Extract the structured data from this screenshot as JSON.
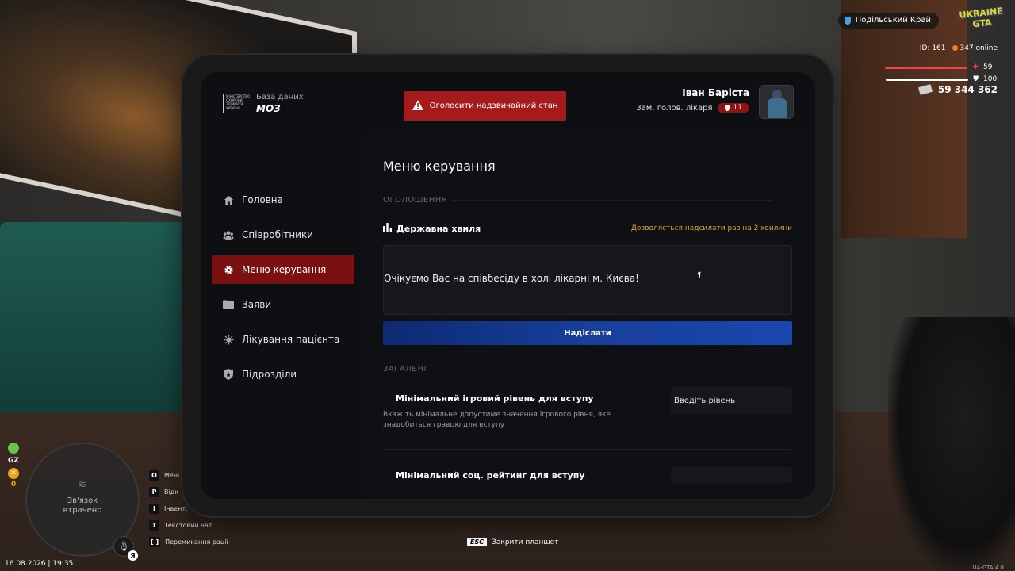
{
  "hud": {
    "region": "Подільський Край",
    "logo_line1": "UKRAINE",
    "logo_line2": "GTA",
    "player_id": "ID: 161",
    "online": "347 online",
    "health": "59",
    "armor": "100",
    "money": "59 344 362",
    "health_color": "#e8474f",
    "armor_color": "#ffffff",
    "stat_letters": "GZ",
    "stat_count": "0",
    "map_status_line1": "Зв'язок",
    "map_status_line2": "втрачено",
    "mic_badge": "Я",
    "datetime": "16.08.2026 | 19:35",
    "hotkeys": [
      {
        "key": "O",
        "label": "Мені"
      },
      {
        "key": "P",
        "label": "Відк"
      },
      {
        "key": "I",
        "label": "Інвент."
      },
      {
        "key": "T",
        "label": "Текстовий чат"
      },
      {
        "key": "[ ]",
        "label": "Перемикання рації"
      }
    ],
    "esc_key": "ESC",
    "esc_label": "Закрити планшет",
    "version": "UA-GTA 4.0"
  },
  "tablet": {
    "brand": {
      "logo_text": "МІНІСТЕРСТВО ОХОРОНИ ЗДОРОВ'Я УКРАЇНИ",
      "subtitle": "База даних",
      "name": "МОЗ"
    },
    "alarm_button": "Оголосити надзвичайний стан",
    "profile": {
      "name": "Іван Баріста",
      "role": "Зам. голов. лікаря",
      "rank": "11"
    },
    "nav": [
      {
        "label": "Головна",
        "icon": "home-icon"
      },
      {
        "label": "Співробітники",
        "icon": "users-icon"
      },
      {
        "label": "Меню керування",
        "icon": "gear-icon",
        "active": true
      },
      {
        "label": "Заяви",
        "icon": "folder-icon"
      },
      {
        "label": "Лікування пацієнта",
        "icon": "virus-icon"
      },
      {
        "label": "Підрозділи",
        "icon": "shield-icon"
      }
    ],
    "main": {
      "title": "Меню керування",
      "section_announcements": "ОГОЛОШЕННЯ",
      "wave_title": "Державна хвиля",
      "wave_note": "Дозволяється надсилати раз на 2 хвилини",
      "message": "Очікуємо Вас на співбесіду в холі лікарні м. Києва!",
      "send_button": "Надіслати",
      "section_general": "ЗАГАЛЬНІ",
      "settings": [
        {
          "title": "Мінімальний ігровий рівень для вступу",
          "description": "Вкажіть мінімальне допустиме значення ігрового рівня, яке знадобиться гравцю для вступу",
          "placeholder": "Введіть рівень"
        },
        {
          "title": "Мінімальний соц. рейтинг для вступу"
        }
      ]
    }
  },
  "colors": {
    "accent_red": "#a51a1a",
    "nav_active": "#7b1010",
    "send_blue": "#173f9b",
    "note_gold": "#d6a634"
  }
}
